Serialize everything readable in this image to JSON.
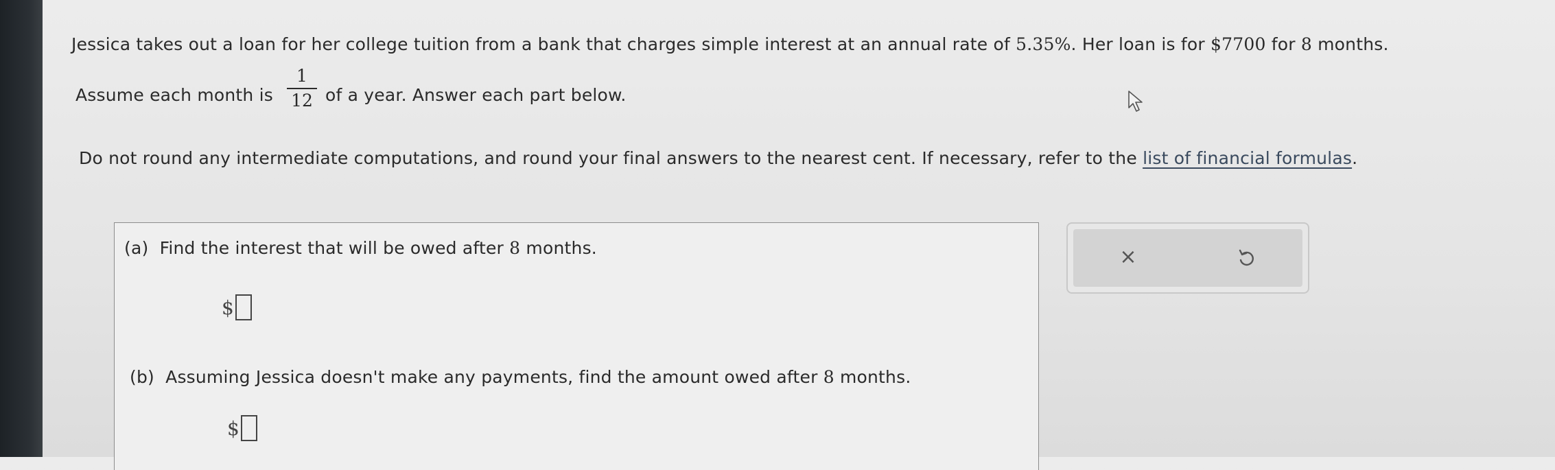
{
  "problem": {
    "line1_pre": "Jessica takes out a loan for her college tuition from a bank that charges simple interest at an annual rate of ",
    "rate": "5.35%",
    "line1_mid": ". Her loan is for ",
    "amount": "$7700",
    "line1_mid2": " for ",
    "months": "8",
    "line1_post": " months.",
    "line2_pre": "Assume each month is",
    "frac_num": "1",
    "frac_den": "12",
    "line2_post": "of a year. Answer each part below.",
    "instructions_pre": "Do not round any intermediate computations, and round your final answers to the nearest cent. If necessary, refer to the ",
    "link_text": "list of financial formulas",
    "instructions_post": "."
  },
  "parts": {
    "a": {
      "label": "(a)",
      "text_pre": "Find the interest that will be owed after ",
      "months": "8",
      "text_post": " months.",
      "prefix": "$",
      "value": ""
    },
    "b": {
      "label": "(b)",
      "text_pre": "Assuming Jessica doesn't make any payments, find the amount owed after ",
      "months": "8",
      "text_post": " months.",
      "prefix": "$",
      "value": ""
    }
  },
  "toolbar": {
    "clear_icon": "close-icon",
    "undo_icon": "undo-icon",
    "clear_glyph": "×"
  }
}
